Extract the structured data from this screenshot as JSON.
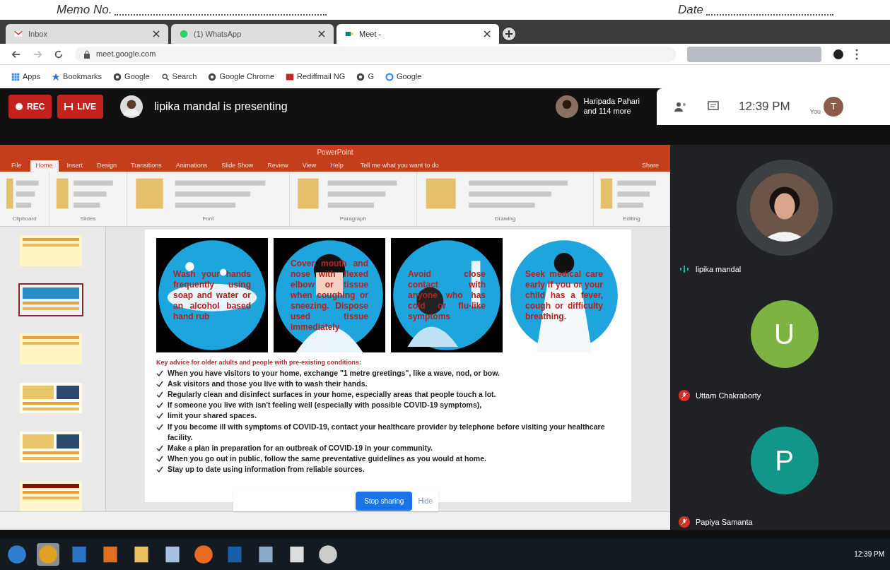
{
  "memo": {
    "number_label": "Memo No.",
    "date_label": "Date"
  },
  "browser": {
    "tabs": [
      {
        "title": "Inbox",
        "selected": false
      },
      {
        "title": "(1) WhatsApp",
        "selected": false
      },
      {
        "title": "Meet - ",
        "selected": true
      }
    ],
    "address": "meet.google.com",
    "bookmarks": [
      "Apps",
      "Bookmarks",
      "Google",
      "Search",
      "Google Chrome",
      "Rediffmail NG",
      "G",
      "Google"
    ]
  },
  "meet": {
    "rec": "REC",
    "live": "LIVE",
    "presenting": "lipika mandal is presenting",
    "others": [
      "Haripada Pahari",
      "and 114 more"
    ],
    "time": "12:39 PM",
    "you": "You",
    "you_initial": "T",
    "participants": [
      {
        "name": "lipika mandal",
        "kind": "video",
        "muted": false
      },
      {
        "name": "Uttam Chakraborty",
        "kind": "initial",
        "initial": "U",
        "color": "#7cb342",
        "muted": true
      },
      {
        "name": "Papiya Samanta",
        "kind": "initial",
        "initial": "P",
        "color": "#129688",
        "muted": true
      }
    ],
    "sharing": {
      "stop": "Stop sharing",
      "hide": "Hide"
    }
  },
  "powerpoint": {
    "title": "PowerPoint",
    "tabs": [
      {
        "label": "File",
        "selected": false
      },
      {
        "label": "Home",
        "selected": true
      },
      {
        "label": "Insert",
        "selected": false
      },
      {
        "label": "Design",
        "selected": false
      },
      {
        "label": "Transitions",
        "selected": false
      },
      {
        "label": "Animations",
        "selected": false
      },
      {
        "label": "Slide Show",
        "selected": false
      },
      {
        "label": "Review",
        "selected": false
      },
      {
        "label": "View",
        "selected": false
      },
      {
        "label": "Help",
        "selected": false
      }
    ],
    "tell_me": "Tell me what you want to do",
    "share": "Share",
    "groups": [
      "Clipboard",
      "Slides",
      "Font",
      "Paragraph",
      "Drawing",
      "Editing"
    ],
    "thumbnails": [
      {
        "selected": false
      },
      {
        "selected": true
      },
      {
        "selected": false
      },
      {
        "selected": false
      },
      {
        "selected": false
      },
      {
        "selected": false
      }
    ],
    "slide": {
      "panels": [
        "Wash your hands frequently using soap and water or an alcohol based hand rub",
        "Cover mouth and nose with flexed elbow or tissue when coughing or sneezing. Dispose used tissue immediately",
        "Avoid close contact with anyone who has cold or flu-like symptoms",
        "Seek medical care early if you or your child has a fever, cough or difficulty breathing."
      ],
      "heading": "Key advice for older adults and people with pre-existing conditions:",
      "items": [
        "When you have visitors to your home, exchange \"1 metre greetings\", like a wave, nod, or bow.",
        "Ask visitors and those you live with to wash their hands.",
        "Regularly clean and disinfect surfaces in your home, especially areas that people touch a lot.",
        "If someone you live with isn't feeling well (especially with possible COVID-19 symptoms),",
        "limit your shared spaces.",
        "If you become ill with symptoms of COVID-19, contact your healthcare provider by telephone before visiting your healthcare facility.",
        "Make a plan in preparation for an outbreak of COVID-19 in your community.",
        "When you go out in public, follow the same preventative guidelines as you would at home.",
        "Stay up to date using information from reliable sources."
      ]
    }
  },
  "taskbar": {
    "clock": "12:39 PM"
  }
}
